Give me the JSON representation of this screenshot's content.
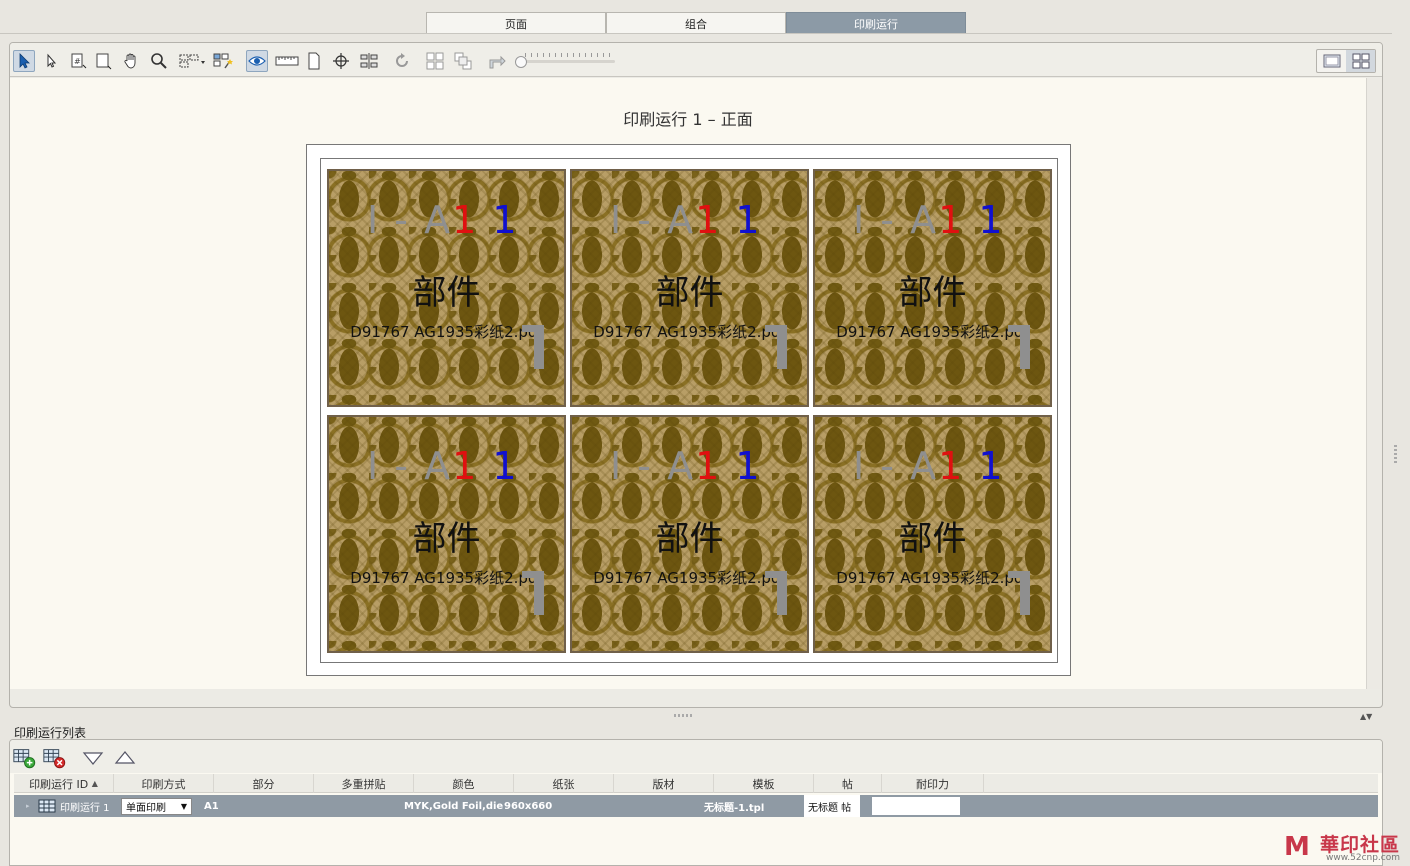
{
  "tabs": [
    {
      "label": "页面",
      "active": false
    },
    {
      "label": "组合",
      "active": false
    },
    {
      "label": "印刷运行",
      "active": true
    }
  ],
  "toolbar": {
    "icons": [
      "pointer-icon",
      "direct-select-icon",
      "page-add-icon",
      "page-icon",
      "hand-icon",
      "zoom-icon",
      "marquee-icon",
      "wand-icon",
      "eye-icon",
      "ruler-icon",
      "document-icon",
      "crosshair-icon",
      "align-icon",
      "rotate-icon",
      "layout-a-icon",
      "layout-b-icon",
      "undo-icon"
    ],
    "view_icons": [
      "single-view-icon",
      "grid-view-icon"
    ]
  },
  "canvas": {
    "title": "印刷运行 1 – 正面",
    "parts": [
      {
        "mark_prefix": "I - A",
        "mark_red": "1",
        "mark_blue": "1",
        "title": "部件",
        "file": "D91767 AG1935彩纸2.pdf"
      },
      {
        "mark_prefix": "I - A",
        "mark_red": "1",
        "mark_blue": "1",
        "title": "部件",
        "file": "D91767 AG1935彩纸2.pdf"
      },
      {
        "mark_prefix": "I - A",
        "mark_red": "1",
        "mark_blue": "1",
        "title": "部件",
        "file": "D91767 AG1935彩纸2.pdf"
      },
      {
        "mark_prefix": "I - A",
        "mark_red": "1",
        "mark_blue": "1",
        "title": "部件",
        "file": "D91767 AG1935彩纸2.pdf"
      },
      {
        "mark_prefix": "I - A",
        "mark_red": "1",
        "mark_blue": "1",
        "title": "部件",
        "file": "D91767 AG1935彩纸2.pdf"
      },
      {
        "mark_prefix": "I - A",
        "mark_red": "1",
        "mark_blue": "1",
        "title": "部件",
        "file": "D91767 AG1935彩纸2.pdf"
      }
    ]
  },
  "list": {
    "title": "印刷运行列表",
    "columns": [
      "印刷运行 ID",
      "印刷方式",
      "部分",
      "多重拼贴",
      "颜色",
      "纸张",
      "版材",
      "模板",
      "帖",
      "耐印力"
    ],
    "row": {
      "id": "印刷运行 1",
      "method": "单面印刷",
      "part": "A1",
      "multi": "",
      "color": "MYK,Gold Foil,die",
      "paper": "960x660",
      "plate": "",
      "template": "无标题-1.tpl",
      "signature": "无标题 帖",
      "run_length": ""
    }
  },
  "watermark": {
    "text": "華印社區",
    "url": "www.52cnp.com"
  },
  "colors": {
    "tab_active": "#8c9aa6",
    "row_selected": "#8f9aa4",
    "mark_red": "#e01010",
    "mark_blue": "#1010d0"
  }
}
